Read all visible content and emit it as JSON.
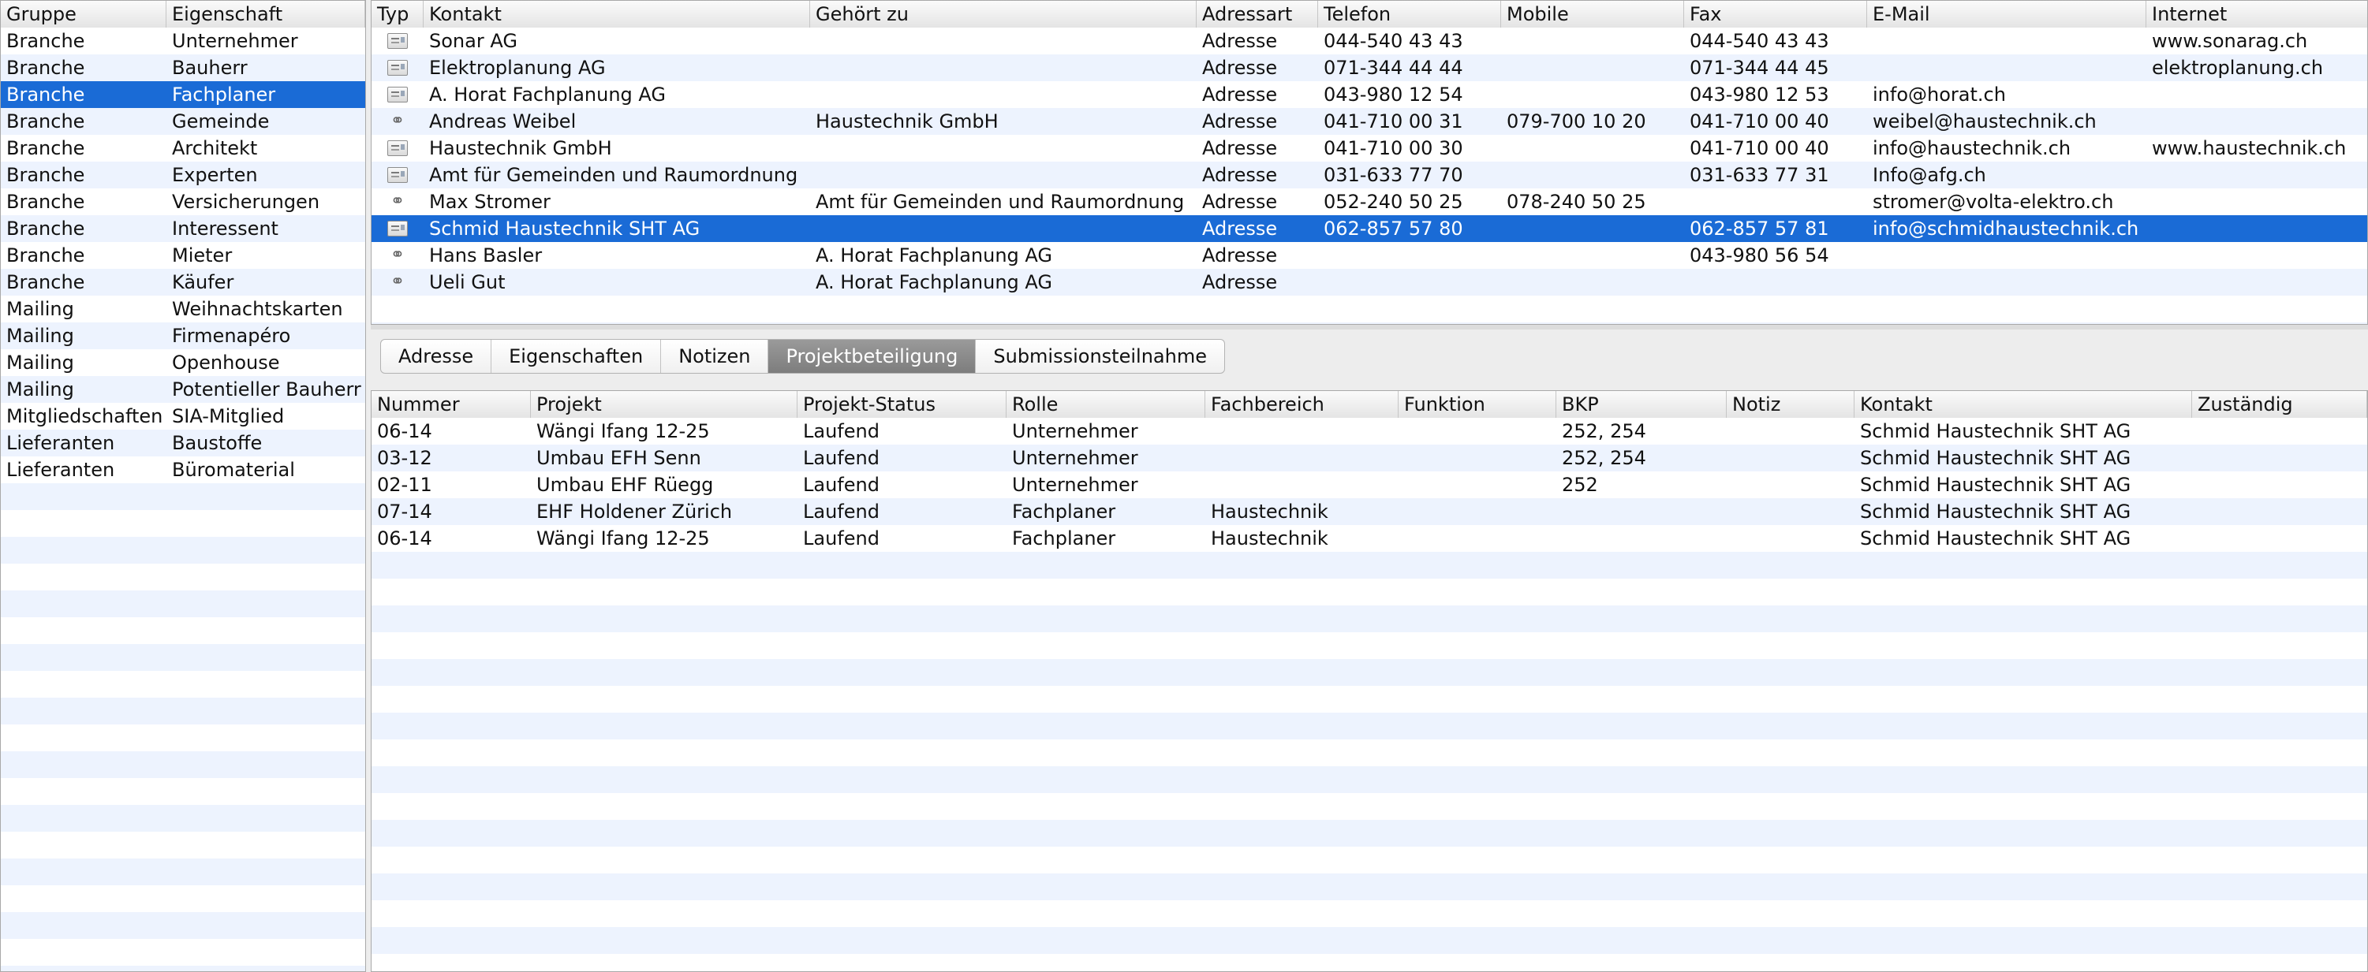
{
  "left_table": {
    "columns": [
      "Gruppe",
      "Eigenschaft"
    ],
    "rows": [
      [
        "Branche",
        "Unternehmer"
      ],
      [
        "Branche",
        "Bauherr"
      ],
      [
        "Branche",
        "Fachplaner"
      ],
      [
        "Branche",
        "Gemeinde"
      ],
      [
        "Branche",
        "Architekt"
      ],
      [
        "Branche",
        "Experten"
      ],
      [
        "Branche",
        "Versicherungen"
      ],
      [
        "Branche",
        "Interessent"
      ],
      [
        "Branche",
        "Mieter"
      ],
      [
        "Branche",
        "Käufer"
      ],
      [
        "Mailing",
        "Weihnachtskarten"
      ],
      [
        "Mailing",
        "Firmenapéro"
      ],
      [
        "Mailing",
        "Openhouse"
      ],
      [
        "Mailing",
        "Potentieller Bauherr"
      ],
      [
        "Mitgliedschaften",
        "SIA-Mitglied"
      ],
      [
        "Lieferanten",
        "Baustoffe"
      ],
      [
        "Lieferanten",
        "Büromaterial"
      ]
    ],
    "selected_index": 2
  },
  "contacts_table": {
    "columns": [
      "Typ",
      "Kontakt",
      "Gehört zu",
      "Adressart",
      "Telefon",
      "Mobile",
      "Fax",
      "E-Mail",
      "Internet"
    ],
    "rows": [
      {
        "type": "card-icon",
        "cells": [
          "Sonar AG",
          "",
          "Adresse",
          "044-540 43 43",
          "",
          "044-540 43 43",
          "",
          "www.sonarag.ch"
        ]
      },
      {
        "type": "card-icon",
        "cells": [
          "Elektroplanung AG",
          "",
          "Adresse",
          "071-344 44 44",
          "",
          "071-344 44 45",
          "",
          "elektroplanung.ch"
        ]
      },
      {
        "type": "card-icon",
        "cells": [
          "A. Horat Fachplanung AG",
          "",
          "Adresse",
          "043-980 12 54",
          "",
          "043-980 12 53",
          "info@horat.ch",
          ""
        ]
      },
      {
        "type": "link-icon",
        "cells": [
          "Andreas Weibel",
          "Haustechnik GmbH",
          "Adresse",
          "041-710 00 31",
          "079-700 10 20",
          "041-710 00 40",
          "weibel@haustechnik.ch",
          ""
        ]
      },
      {
        "type": "card-icon",
        "cells": [
          "Haustechnik GmbH",
          "",
          "Adresse",
          "041-710 00 30",
          "",
          "041-710 00 40",
          "info@haustechnik.ch",
          "www.haustechnik.ch"
        ]
      },
      {
        "type": "card-icon",
        "cells": [
          "Amt für Gemeinden und Raumordnung",
          "",
          "Adresse",
          "031-633 77 70",
          "",
          "031-633 77 31",
          "Info@afg.ch",
          ""
        ]
      },
      {
        "type": "link-icon",
        "cells": [
          "Max Stromer",
          "Amt für Gemeinden und Raumordnung",
          "Adresse",
          "052-240 50 25",
          "078-240 50 25",
          "",
          "stromer@volta-elektro.ch",
          ""
        ]
      },
      {
        "type": "card-icon",
        "cells": [
          "Schmid Haustechnik SHT AG",
          "",
          "Adresse",
          "062-857 57 80",
          "",
          "062-857 57 81",
          "info@schmidhaustechnik.ch",
          ""
        ]
      },
      {
        "type": "link-icon",
        "cells": [
          "Hans Basler",
          "A. Horat Fachplanung AG",
          "Adresse",
          "",
          "",
          "043-980 56 54",
          "",
          ""
        ]
      },
      {
        "type": "link-icon",
        "cells": [
          "Ueli Gut",
          "A. Horat Fachplanung AG",
          "Adresse",
          "",
          "",
          "",
          "",
          ""
        ]
      }
    ],
    "selected_index": 7
  },
  "tabs": [
    {
      "label": "Adresse",
      "active": false
    },
    {
      "label": "Eigenschaften",
      "active": false
    },
    {
      "label": "Notizen",
      "active": false
    },
    {
      "label": "Projektbeteiligung",
      "active": true
    },
    {
      "label": "Submissionsteilnahme",
      "active": false
    }
  ],
  "projects_table": {
    "columns": [
      "Nummer",
      "Projekt",
      "Projekt-Status",
      "Rolle",
      "Fachbereich",
      "Funktion",
      "BKP",
      "Notiz",
      "Kontakt",
      "Zuständig"
    ],
    "rows": [
      [
        "06-14",
        "Wängi Ifang 12-25",
        "Laufend",
        "Unternehmer",
        "",
        "",
        "252, 254",
        "",
        "Schmid Haustechnik SHT AG",
        ""
      ],
      [
        "03-12",
        "Umbau EFH Senn",
        "Laufend",
        "Unternehmer",
        "",
        "",
        "252, 254",
        "",
        "Schmid Haustechnik SHT AG",
        ""
      ],
      [
        "02-11",
        "Umbau EHF Rüegg",
        "Laufend",
        "Unternehmer",
        "",
        "",
        "252",
        "",
        "Schmid Haustechnik SHT AG",
        ""
      ],
      [
        "07-14",
        "EHF Holdener Zürich",
        "Laufend",
        "Fachplaner",
        "Haustechnik",
        "",
        "",
        "",
        "Schmid Haustechnik SHT AG",
        ""
      ],
      [
        "06-14",
        "Wängi Ifang 12-25",
        "Laufend",
        "Fachplaner",
        "Haustechnik",
        "",
        "",
        "",
        "Schmid Haustechnik SHT AG",
        ""
      ]
    ]
  }
}
